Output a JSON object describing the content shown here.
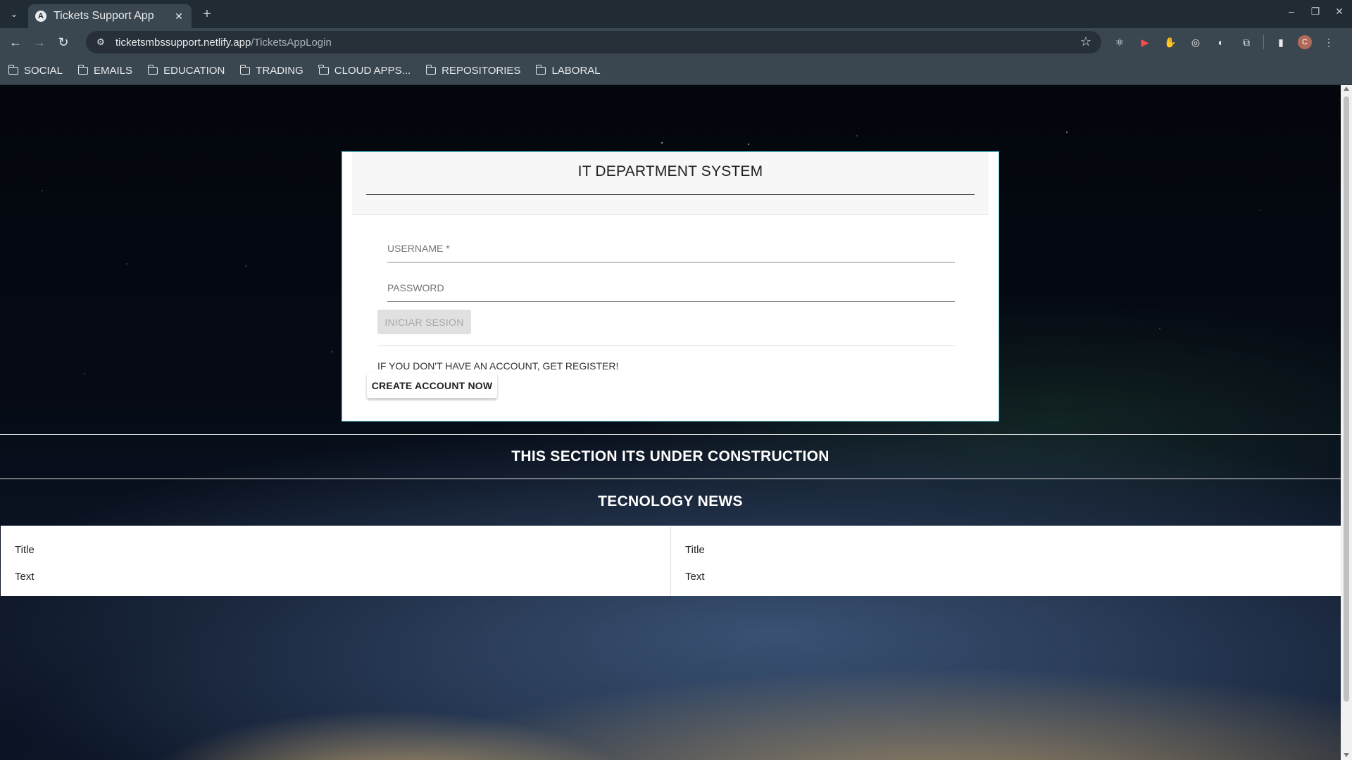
{
  "browser": {
    "tab": {
      "favicon_letter": "A",
      "title": "Tickets Support App",
      "close": "✕"
    },
    "new_tab": "+",
    "window_controls": {
      "minimize": "–",
      "restore": "❐",
      "close": "✕"
    },
    "nav": {
      "back": "←",
      "forward": "→",
      "reload": "↻"
    },
    "url": {
      "host": "ticketsmbssupport.netlify.app",
      "path": "/TicketsAppLogin"
    },
    "avatar_letter": "C",
    "bookmarks": [
      "SOCIAL",
      "EMAILS",
      "EDUCATION",
      "TRADING",
      "CLOUD APPS...",
      "REPOSITORIES",
      "LABORAL"
    ]
  },
  "login": {
    "title": "IT DEPARTMENT SYSTEM",
    "username_placeholder": "USERNAME *",
    "password_placeholder": "PASSWORD",
    "login_button": "INICIAR SESION",
    "register_text": "IF YOU DON'T HAVE AN ACCOUNT, GET REGISTER!",
    "create_button": "CREATE ACCOUNT NOW"
  },
  "sections": {
    "construction": "THIS SECTION ITS UNDER CONSTRUCTION",
    "news_title": "TECNOLOGY NEWS"
  },
  "news": [
    {
      "title": "Title",
      "text": "Text"
    },
    {
      "title": "Title",
      "text": "Text"
    }
  ],
  "colors": {
    "card_border": "#55c2c9",
    "chrome_bg": "#3a4750",
    "tabstrip_bg": "#202b33"
  }
}
